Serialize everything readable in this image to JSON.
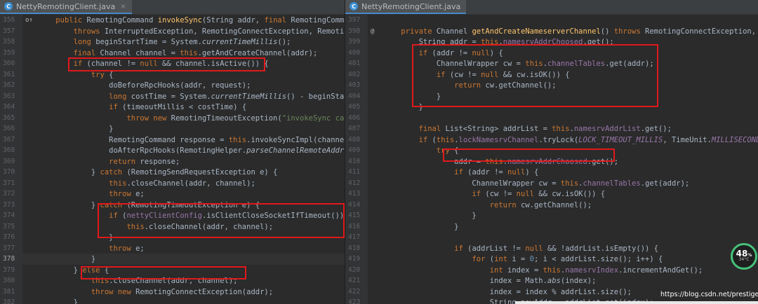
{
  "left": {
    "tab_title": "NettyRemotingClient.java",
    "tab_close": "×",
    "lines": [
      {
        "num": "356",
        "marker": "o↑",
        "text": "    public RemotingCommand invokeSync(String addr, final RemotingCommand req"
      },
      {
        "num": "357",
        "text": "        throws InterruptedException, RemotingConnectException, RemotingSendR"
      },
      {
        "num": "358",
        "text": "        long beginStartTime = System.currentTimeMillis();"
      },
      {
        "num": "359",
        "text": "        final Channel channel = this.getAndCreateChannel(addr);"
      },
      {
        "num": "360",
        "text": "        if (channel != null && channel.isActive()) {"
      },
      {
        "num": "361",
        "text": "            try {"
      },
      {
        "num": "362",
        "text": "                doBeforeRpcHooks(addr, request);"
      },
      {
        "num": "363",
        "text": "                long costTime = System.currentTimeMillis() - beginStartTime;"
      },
      {
        "num": "364",
        "text": "                if (timeoutMillis < costTime) {"
      },
      {
        "num": "365",
        "text": "                    throw new RemotingTimeoutException(\"invokeSync call time"
      },
      {
        "num": "366",
        "text": "                }"
      },
      {
        "num": "367",
        "text": "                RemotingCommand response = this.invokeSyncImpl(channel, requ"
      },
      {
        "num": "368",
        "text": "                doAfterRpcHooks(RemotingHelper.parseChannelRemoteAddr(channe"
      },
      {
        "num": "369",
        "text": "                return response;"
      },
      {
        "num": "370",
        "text": "            } catch (RemotingSendRequestException e) {"
      },
      {
        "num": "371",
        "text": "                this.closeChannel(addr, channel);"
      },
      {
        "num": "372",
        "text": "                throw e;"
      },
      {
        "num": "373",
        "text": "            } catch (RemotingTimeoutException e) {"
      },
      {
        "num": "374",
        "text": "                if (nettyClientConfig.isClientCloseSocketIfTimeout()) {"
      },
      {
        "num": "375",
        "text": "                    this.closeChannel(addr, channel);"
      },
      {
        "num": "376",
        "text": "                }"
      },
      {
        "num": "377",
        "text": "                throw e;"
      },
      {
        "num": "378",
        "text": "            }"
      },
      {
        "num": "379",
        "text": "        } else {"
      },
      {
        "num": "380",
        "text": "            this.closeChannel(addr, channel);"
      },
      {
        "num": "381",
        "text": "            throw new RemotingConnectException(addr);"
      },
      {
        "num": "382",
        "text": "        }"
      }
    ]
  },
  "right": {
    "tab_title": "NettyRemotingClient.java",
    "lines": [
      {
        "num": "397",
        "text": ""
      },
      {
        "num": "398",
        "marker": "@",
        "text": "    private Channel getAndCreateNameserverChannel() throws RemotingConnectException, Interrup"
      },
      {
        "num": "399",
        "text": "        String addr = this.namesrvAddrChoosed.get();"
      },
      {
        "num": "400",
        "text": "        if (addr != null) {"
      },
      {
        "num": "401",
        "text": "            ChannelWrapper cw = this.channelTables.get(addr);"
      },
      {
        "num": "402",
        "text": "            if (cw != null && cw.isOK()) {"
      },
      {
        "num": "403",
        "text": "                return cw.getChannel();"
      },
      {
        "num": "404",
        "text": "            }"
      },
      {
        "num": "405",
        "text": "        }"
      },
      {
        "num": "406",
        "text": ""
      },
      {
        "num": "407",
        "text": "        final List<String> addrList = this.namesrvAddrList.get();"
      },
      {
        "num": "408",
        "text": "        if (this.lockNamesrvChannel.tryLock(LOCK_TIMEOUT_MILLIS, TimeUnit.MILLISECONDS)) {"
      },
      {
        "num": "409",
        "text": "            try {"
      },
      {
        "num": "410",
        "text": "                addr = this.namesrvAddrChoosed.get();"
      },
      {
        "num": "411",
        "text": "                if (addr != null) {"
      },
      {
        "num": "412",
        "text": "                    ChannelWrapper cw = this.channelTables.get(addr);"
      },
      {
        "num": "413",
        "text": "                    if (cw != null && cw.isOK()) {"
      },
      {
        "num": "414",
        "text": "                        return cw.getChannel();"
      },
      {
        "num": "415",
        "text": "                    }"
      },
      {
        "num": "416",
        "text": "                }"
      },
      {
        "num": "417",
        "text": ""
      },
      {
        "num": "418",
        "text": "                if (addrList != null && !addrList.isEmpty()) {"
      },
      {
        "num": "419",
        "text": "                    for (int i = 0; i < addrList.size(); i++) {"
      },
      {
        "num": "420",
        "text": "                        int index = this.namesrvIndex.incrementAndGet();"
      },
      {
        "num": "421",
        "text": "                        index = Math.abs(index);"
      },
      {
        "num": "422",
        "text": "                        index = index % addrList.size();"
      },
      {
        "num": "423",
        "text": "                        String newAddr = addrList.get(index);"
      }
    ]
  },
  "badge": {
    "percent": "48",
    "percent_sign": "%",
    "temp": "34°C"
  },
  "watermark": "https://blog.csdn.net/prestigeding",
  "colors": {
    "highlight_box": "#e0191b",
    "background": "#2b2b2b",
    "keyword": "#cc7832",
    "field": "#9876aa",
    "method": "#ffc66d",
    "string": "#6a8759",
    "number": "#6897bb"
  }
}
